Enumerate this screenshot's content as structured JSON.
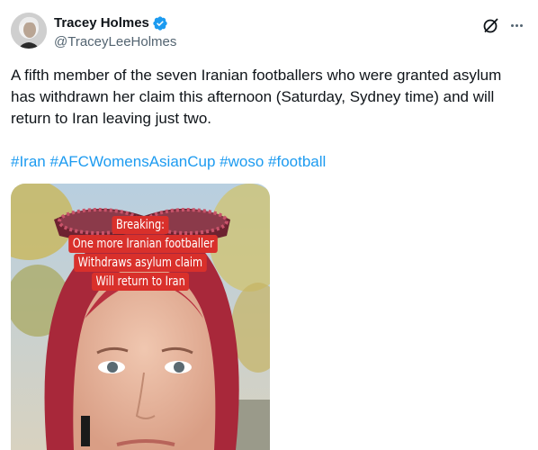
{
  "author": {
    "display_name": "Tracey Holmes",
    "handle": "@TraceyLeeHolmes",
    "verified": true,
    "verified_color": "#1d9bf0"
  },
  "header_icons": [
    "grok-icon",
    "more-icon"
  ],
  "tweet": {
    "text": "A fifth member of the seven Iranian footballers who were granted asylum has withdrawn her claim this afternoon (Saturday, Sydney time) and will return to Iran leaving just two.",
    "hashtags": [
      "#Iran",
      "#AFCWomensAsianCup",
      "#woso",
      "#football"
    ],
    "link_color": "#1d9bf0"
  },
  "media": {
    "caption_lines": [
      "Breaking:",
      "One more Iranian footballer",
      "Withdraws asylum claim",
      "Will return to Iran"
    ],
    "caption_bg": "#d9302b"
  }
}
